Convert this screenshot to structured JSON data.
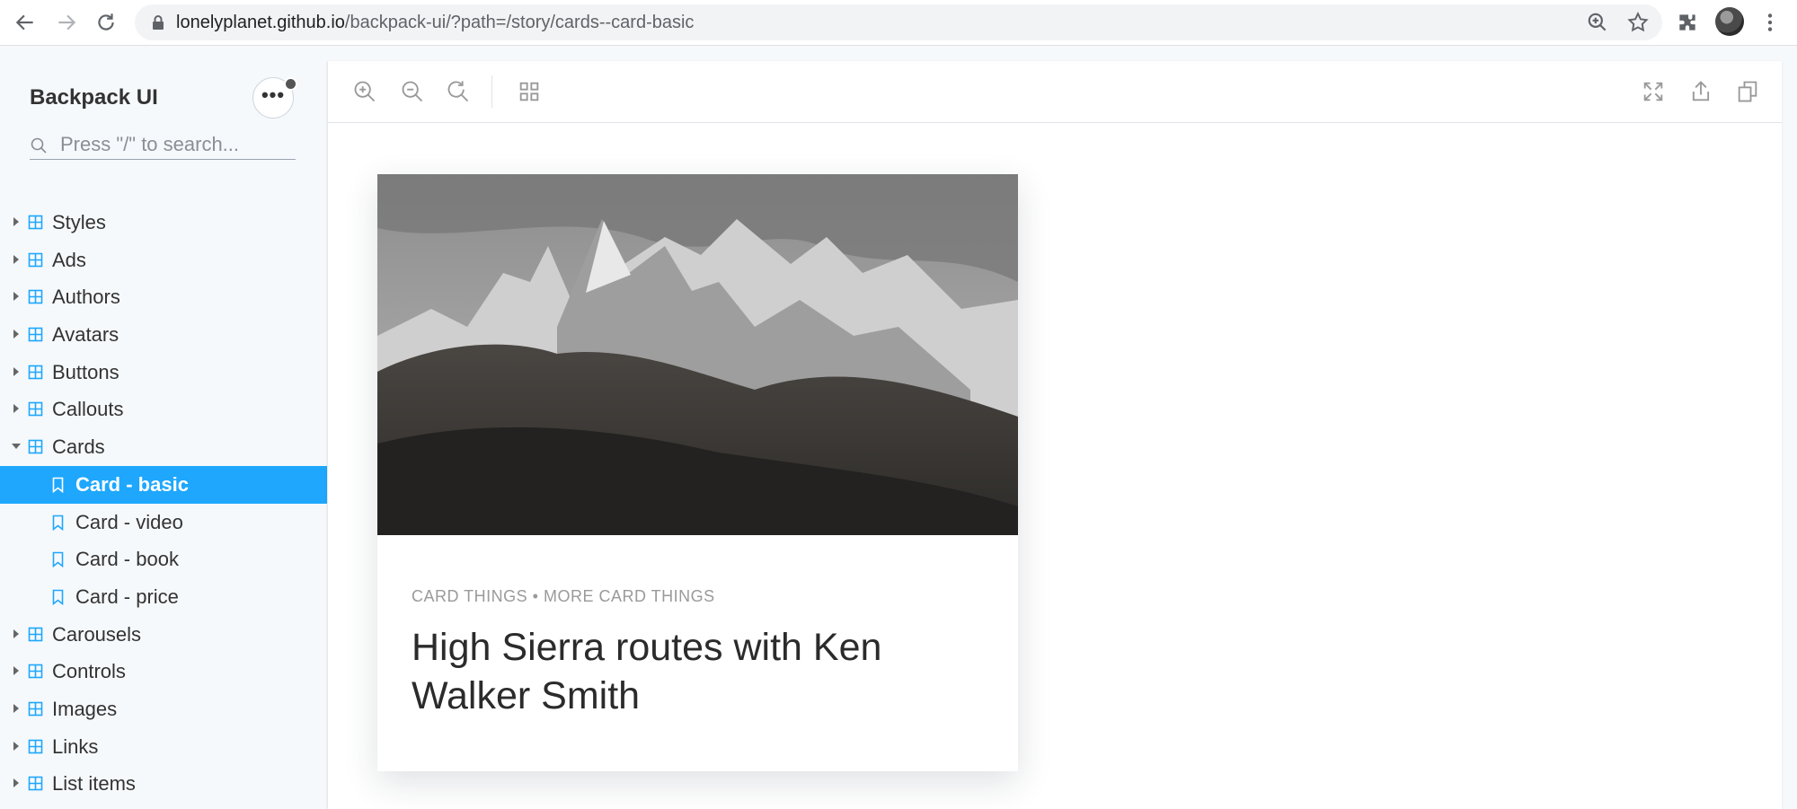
{
  "browser": {
    "url_host": "lonelyplanet.github.io",
    "url_path": "/backpack-ui/?path=/story/cards--card-basic",
    "icons": [
      "back-icon",
      "forward-icon",
      "reload-icon",
      "lock-icon",
      "zoom-icon",
      "star-icon",
      "extensions-icon",
      "profile-avatar",
      "more-icon"
    ]
  },
  "sidebar": {
    "brand": "Backpack UI",
    "search_placeholder": "Press \"/\" to search...",
    "items": [
      {
        "label": "Styles"
      },
      {
        "label": "Ads"
      },
      {
        "label": "Authors"
      },
      {
        "label": "Avatars"
      },
      {
        "label": "Buttons"
      },
      {
        "label": "Callouts"
      },
      {
        "label": "Cards",
        "expanded": true,
        "children": [
          {
            "label": "Card - basic",
            "selected": true
          },
          {
            "label": "Card - video"
          },
          {
            "label": "Card - book"
          },
          {
            "label": "Card - price"
          }
        ]
      },
      {
        "label": "Carousels"
      },
      {
        "label": "Controls"
      },
      {
        "label": "Images"
      },
      {
        "label": "Links"
      },
      {
        "label": "List items"
      }
    ]
  },
  "toolbar": {
    "icons": [
      "zoom-in-icon",
      "zoom-out-icon",
      "zoom-reset-icon",
      "grid-icon",
      "fullscreen-icon",
      "share-icon",
      "copy-icon"
    ]
  },
  "card": {
    "meta": "CARD THINGS • MORE CARD THINGS",
    "title": "High Sierra routes with Ken Walker Smith"
  },
  "colors": {
    "accent": "#1ea7fd",
    "sidebar_bg": "#f6f9fc",
    "text": "#333333",
    "meta_text": "#9a9a9a"
  }
}
